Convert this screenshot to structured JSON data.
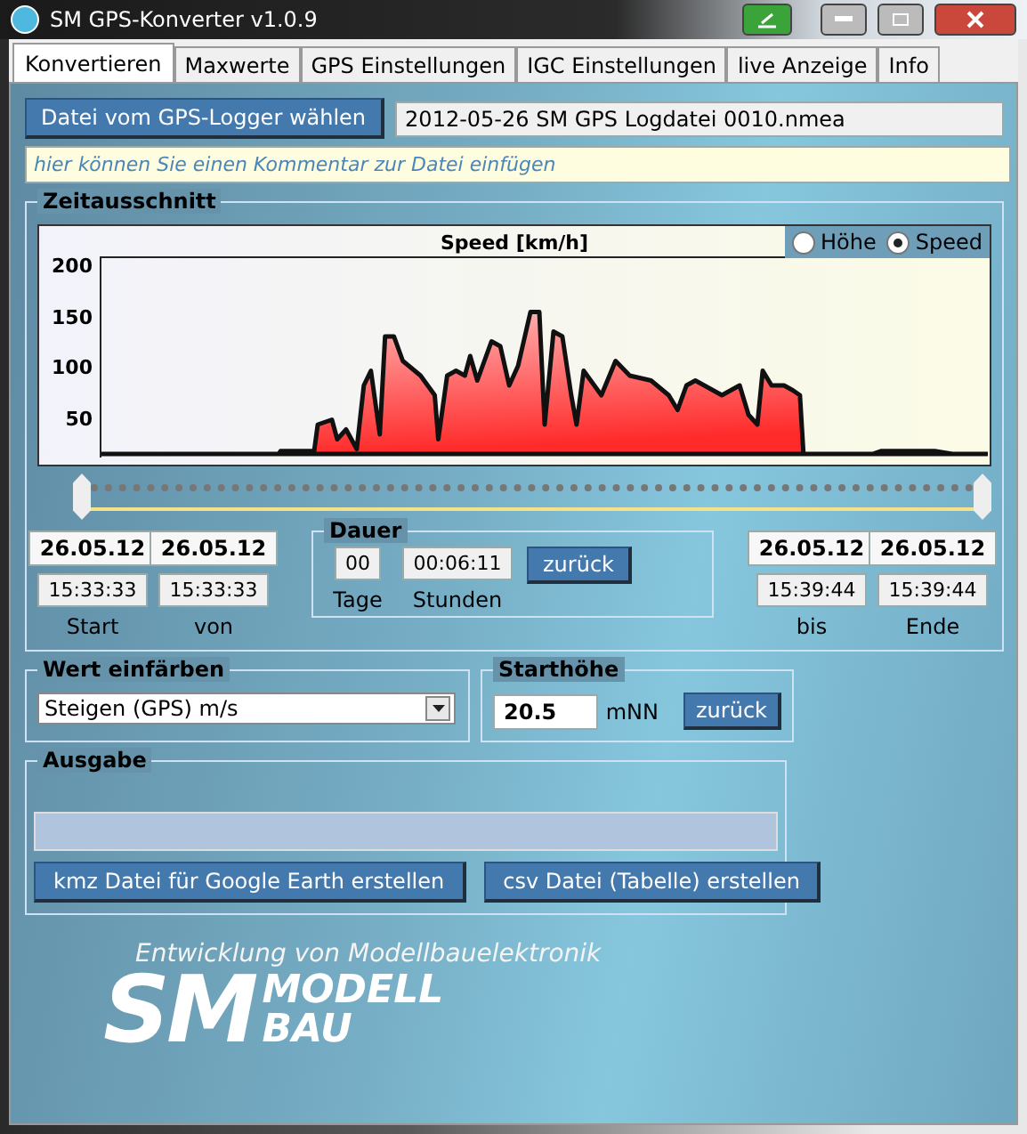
{
  "window": {
    "title": "SM GPS-Konverter v1.0.9"
  },
  "tabs": [
    {
      "label": "Konvertieren",
      "selected": true
    },
    {
      "label": "Maxwerte",
      "selected": false
    },
    {
      "label": "GPS Einstellungen",
      "selected": false
    },
    {
      "label": "IGC Einstellungen",
      "selected": false
    },
    {
      "label": "live Anzeige",
      "selected": false
    },
    {
      "label": "Info",
      "selected": false
    }
  ],
  "file": {
    "button": "Datei vom GPS-Logger wählen",
    "value": "2012-05-26 SM GPS Logdatei 0010.nmea"
  },
  "comment": {
    "placeholder": "hier können Sie einen Kommentar zur Datei einfügen"
  },
  "zeitausschnitt": {
    "title": "Zeitausschnitt",
    "chart": {
      "title": "Speed [km/h]",
      "yticks": [
        "200",
        "150",
        "100",
        "50"
      ]
    },
    "modes": [
      {
        "label": "Höhe",
        "selected": false
      },
      {
        "label": "Speed",
        "selected": true
      }
    ],
    "start": {
      "date": "26.05.12",
      "time": "15:33:33",
      "label": "Start"
    },
    "von": {
      "date": "26.05.12",
      "time": "15:33:33",
      "label": "von"
    },
    "dauer": {
      "title": "Dauer",
      "days": "00",
      "hours": "00:06:11",
      "days_label": "Tage",
      "hours_label": "Stunden",
      "button": "zurück"
    },
    "bis": {
      "date": "26.05.12",
      "time": "15:39:44",
      "label": "bis"
    },
    "ende": {
      "date": "26.05.12",
      "time": "15:39:44",
      "label": "Ende"
    }
  },
  "wert": {
    "title": "Wert einfärben",
    "value": "Steigen (GPS) m/s"
  },
  "starthoehe": {
    "title": "Starthöhe",
    "value": "20.5",
    "unit": "mNN",
    "button": "zurück"
  },
  "ausgabe": {
    "title": "Ausgabe",
    "progress": {
      "level": 0
    },
    "buttons": [
      "kmz Datei für Google Earth erstellen",
      "csv Datei (Tabelle) erstellen"
    ]
  },
  "logo": {
    "tagline": "Entwicklung von Modellbauelektronik",
    "mark": "SM",
    "line1": "MODELL",
    "line2": "BAU"
  }
}
